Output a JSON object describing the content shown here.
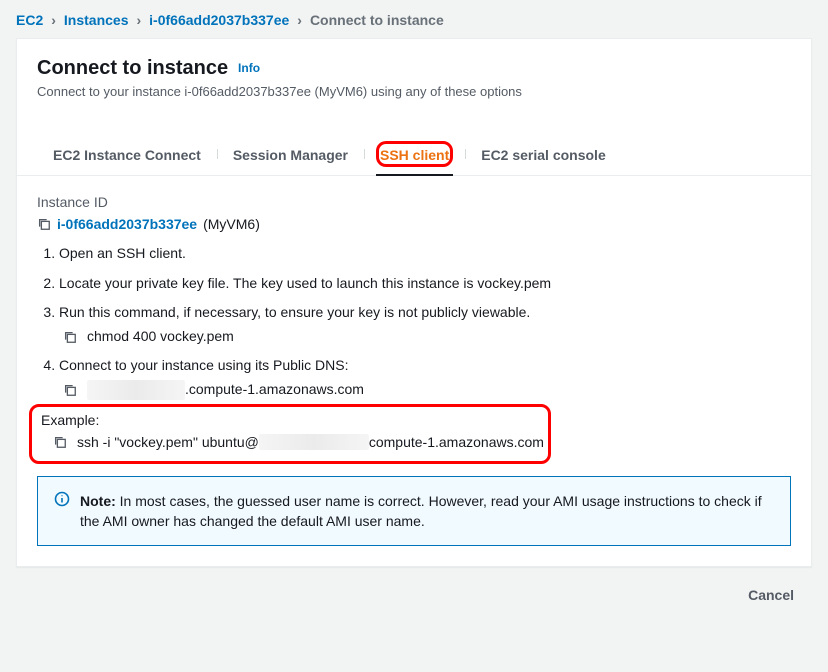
{
  "breadcrumbs": {
    "root": "EC2",
    "instances": "Instances",
    "id": "i-0f66add2037b337ee",
    "current": "Connect to instance"
  },
  "header": {
    "title": "Connect to instance",
    "info": "Info",
    "subtitle": "Connect to your instance i-0f66add2037b337ee (MyVM6) using any of these options"
  },
  "tabs": {
    "ec2_connect": "EC2 Instance Connect",
    "session_manager": "Session Manager",
    "ssh": "SSH client",
    "serial": "EC2 serial console"
  },
  "main": {
    "instance_id_label": "Instance ID",
    "instance_id": "i-0f66add2037b337ee",
    "instance_name": "(MyVM6)",
    "steps": {
      "s1": "Open an SSH client.",
      "s2": "Locate your private key file. The key used to launch this instance is vockey.pem",
      "s3": "Run this command, if necessary, to ensure your key is not publicly viewable.",
      "s3_cmd": "chmod 400 vockey.pem",
      "s4": "Connect to your instance using its Public DNS:",
      "s4_dns_suffix": ".compute-1.amazonaws.com"
    },
    "example": {
      "label": "Example:",
      "ssh_prefix": "ssh -i \"vockey.pem\" ubuntu@",
      "ssh_suffix": "compute-1.amazonaws.com"
    },
    "note": {
      "prefix": "Note:",
      "text": " In most cases, the guessed user name is correct. However, read your AMI usage instructions to check if the AMI owner has changed the default AMI user name."
    }
  },
  "footer": {
    "cancel": "Cancel"
  }
}
